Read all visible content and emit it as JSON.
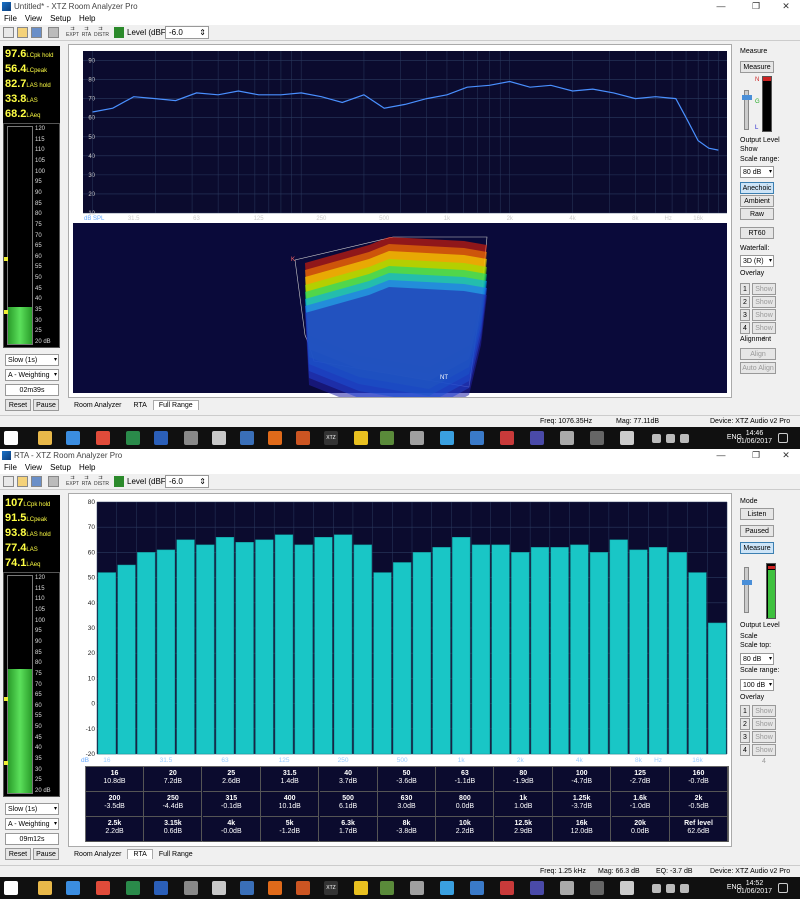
{
  "win1": {
    "title": "Untitled* - XTZ Room Analyzer Pro",
    "menu": [
      "File",
      "View",
      "Setup",
      "Help"
    ],
    "toolbar_small": [
      "EXPT",
      "RTA",
      "DISTR"
    ],
    "level_label": "Level (dBFS)",
    "level_value": "-6.0",
    "readouts": [
      {
        "value": "97.6",
        "unit": "LCpk hold"
      },
      {
        "value": "56.4",
        "unit": "LCpeak"
      },
      {
        "value": "82.7",
        "unit": "LAS hold"
      },
      {
        "value": "33.8",
        "unit": "LAS"
      },
      {
        "value": "68.2",
        "unit": "LAeq"
      }
    ],
    "meter_ticks": [
      "120",
      "115",
      "110",
      "105",
      "100",
      "95",
      "90",
      "85",
      "80",
      "75",
      "70",
      "65",
      "60",
      "55",
      "50",
      "45",
      "40",
      "35",
      "30",
      "25",
      "20 dB"
    ],
    "meter_level": 0.17,
    "speed": "Slow (1s)",
    "weighting": "A - Weighting",
    "timer": "02m39s",
    "reset": "Reset",
    "pause": "Pause",
    "fr_chart": {
      "y_ticks": [
        "90",
        "80",
        "70",
        "60",
        "50",
        "40",
        "30",
        "20",
        "10"
      ],
      "x_ticks": [
        "31.5",
        "63",
        "125",
        "250",
        "500",
        "1k",
        "2k",
        "4k",
        "8k",
        "Hz",
        "16k"
      ],
      "ylabel": "dB SPL"
    },
    "waterfall_labels": {
      "top": "K",
      "bottom": "NT"
    },
    "tabs": [
      "Room Analyzer",
      "RTA",
      "Full Range"
    ],
    "status": {
      "freq": "Freq: 1076.35Hz",
      "mag": "Mag: 77.11dB",
      "device": "Device: XTZ Audio v2 Pro"
    },
    "right": {
      "measure_title": "Measure",
      "measure_btn": "Measure",
      "output_level": "Output Level",
      "show": "Show",
      "scale_range": "Scale range:",
      "scale_val": "80 dB",
      "anechoic": "Anechoic",
      "ambient": "Ambient",
      "raw": "Raw",
      "rt60": "RT60",
      "waterfall": "Waterfall:",
      "waterfall_val": "3D (R)",
      "overlay": "Overlay",
      "overlay_items": [
        {
          "n": "1",
          "l": "Show 1"
        },
        {
          "n": "2",
          "l": "Show 2"
        },
        {
          "n": "3",
          "l": "Show 3"
        },
        {
          "n": "4",
          "l": "Show 4"
        }
      ],
      "alignment": "Alignment",
      "align_delay": "Align Delay",
      "auto_align": "Auto Align"
    }
  },
  "taskbar1": {
    "lang": "ENG",
    "time": "14:46",
    "date": "01/06/2017",
    "label": "XTZ"
  },
  "win2": {
    "title": "RTA - XTZ Room Analyzer Pro",
    "menu": [
      "File",
      "View",
      "Setup",
      "Help"
    ],
    "toolbar_small": [
      "EXPT",
      "RTA",
      "DISTR"
    ],
    "level_label": "Level (dBFS)",
    "level_value": "-6.0",
    "readouts": [
      {
        "value": "107",
        "unit": "LCpk hold"
      },
      {
        "value": "91.5",
        "unit": "LCpeak"
      },
      {
        "value": "93.8",
        "unit": "LAS hold"
      },
      {
        "value": "77.4",
        "unit": "LAS"
      },
      {
        "value": "74.1",
        "unit": "LAeq"
      }
    ],
    "meter_ticks": [
      "120",
      "115",
      "110",
      "105",
      "100",
      "95",
      "90",
      "85",
      "80",
      "75",
      "70",
      "65",
      "60",
      "55",
      "50",
      "45",
      "40",
      "35",
      "30",
      "25",
      "20 dB"
    ],
    "meter_level": 0.57,
    "speed": "Slow (1s)",
    "weighting": "A - Weighting",
    "timer": "09m12s",
    "reset": "Reset",
    "pause": "Pause",
    "tabs": [
      "Room Analyzer",
      "RTA",
      "Full Range"
    ],
    "status": {
      "freq": "Freq: 1.25 kHz",
      "mag": "Mag: 66.3 dB",
      "eq": "EQ: -3.7 dB",
      "device": "Device: XTZ Audio v2 Pro"
    },
    "right": {
      "mode": "Mode",
      "listen": "Listen",
      "paused": "Paused",
      "measure": "Measure",
      "output_level": "Output Level",
      "scale": "Scale",
      "scale_top": "Scale top:",
      "scale_top_val": "80 dB",
      "scale_range": "Scale range:",
      "scale_range_val": "100 dB",
      "overlay": "Overlay",
      "overlay_items": [
        {
          "n": "1",
          "l": "Show 1"
        },
        {
          "n": "2",
          "l": "Show 2"
        },
        {
          "n": "3",
          "l": "Show 3"
        },
        {
          "n": "4",
          "l": "Show 4"
        }
      ]
    },
    "table": [
      [
        {
          "f": "16",
          "v": "10.8dB"
        },
        {
          "f": "20",
          "v": "7.2dB"
        },
        {
          "f": "25",
          "v": "2.6dB"
        },
        {
          "f": "31.5",
          "v": "1.4dB"
        },
        {
          "f": "40",
          "v": "3.7dB"
        },
        {
          "f": "50",
          "v": "-3.6dB"
        },
        {
          "f": "63",
          "v": "-1.1dB"
        },
        {
          "f": "80",
          "v": "-1.9dB"
        },
        {
          "f": "100",
          "v": "-4.7dB"
        },
        {
          "f": "125",
          "v": "-2.7dB"
        },
        {
          "f": "160",
          "v": "-0.7dB"
        }
      ],
      [
        {
          "f": "200",
          "v": "-3.5dB"
        },
        {
          "f": "250",
          "v": "-4.4dB"
        },
        {
          "f": "315",
          "v": "-0.1dB"
        },
        {
          "f": "400",
          "v": "10.1dB"
        },
        {
          "f": "500",
          "v": "6.1dB"
        },
        {
          "f": "630",
          "v": "3.0dB"
        },
        {
          "f": "800",
          "v": "0.0dB"
        },
        {
          "f": "1k",
          "v": "1.0dB"
        },
        {
          "f": "1.25k",
          "v": "-3.7dB"
        },
        {
          "f": "1.6k",
          "v": "-1.0dB"
        },
        {
          "f": "2k",
          "v": "-0.5dB"
        }
      ],
      [
        {
          "f": "2.5k",
          "v": "2.2dB"
        },
        {
          "f": "3.15k",
          "v": "0.6dB"
        },
        {
          "f": "4k",
          "v": "-0.0dB"
        },
        {
          "f": "5k",
          "v": "-1.2dB"
        },
        {
          "f": "6.3k",
          "v": "1.7dB"
        },
        {
          "f": "8k",
          "v": "-3.8dB"
        },
        {
          "f": "10k",
          "v": "2.2dB"
        },
        {
          "f": "12.5k",
          "v": "2.9dB"
        },
        {
          "f": "16k",
          "v": "12.0dB"
        },
        {
          "f": "20k",
          "v": "0.0dB"
        },
        {
          "f": "Ref level",
          "v": "62.6dB"
        }
      ]
    ]
  },
  "taskbar2": {
    "lang": "ENG",
    "time": "14:52",
    "date": "01/06/2017",
    "label": "XTZ"
  },
  "chart_data": [
    {
      "type": "line",
      "ylabel": "dB SPL",
      "ylim": [
        10,
        95
      ],
      "x_scale": "log",
      "x": [
        20,
        25,
        31.5,
        40,
        50,
        63,
        80,
        100,
        125,
        160,
        200,
        250,
        315,
        400,
        500,
        630,
        800,
        1000,
        1250,
        1600,
        2000,
        2500,
        3150,
        4000,
        5000,
        6300,
        8000,
        10000,
        12500,
        14000,
        16000,
        18000,
        20000
      ],
      "y": [
        63,
        65,
        71,
        70,
        69,
        73,
        72,
        74,
        72,
        72,
        73,
        71,
        68,
        72,
        65,
        67,
        70,
        72,
        76,
        77,
        79,
        76,
        77,
        74,
        75,
        73,
        70,
        71,
        70,
        60,
        48,
        44,
        43
      ],
      "grid": true
    },
    {
      "type": "bar",
      "categories": [
        "16",
        "20",
        "25",
        "31.5",
        "40",
        "50",
        "63",
        "80",
        "100",
        "125",
        "160",
        "200",
        "250",
        "315",
        "400",
        "500",
        "630",
        "800",
        "1k",
        "1.25k",
        "1.6k",
        "2k",
        "2.5k",
        "3.15k",
        "4k",
        "5k",
        "6.3k",
        "8k",
        "10k",
        "12.5k",
        "16k",
        "20k"
      ],
      "values": [
        52,
        55,
        60,
        61,
        65,
        63,
        66,
        64,
        65,
        67,
        63,
        66,
        67,
        63,
        52,
        56,
        60,
        62,
        66,
        63,
        63,
        60,
        62,
        62,
        63,
        60,
        65,
        61,
        62,
        60,
        52,
        32
      ],
      "ylim": [
        -20,
        80
      ],
      "y_ticks": [
        "80",
        "70",
        "60",
        "50",
        "40",
        "30",
        "20",
        "10",
        "0",
        "-10",
        "-20"
      ],
      "x_ticks": [
        "16",
        "31.5",
        "63",
        "125",
        "250",
        "500",
        "1k",
        "2k",
        "4k",
        "8k",
        "Hz",
        "16k"
      ],
      "ylabel": "dB",
      "grid": true
    }
  ]
}
